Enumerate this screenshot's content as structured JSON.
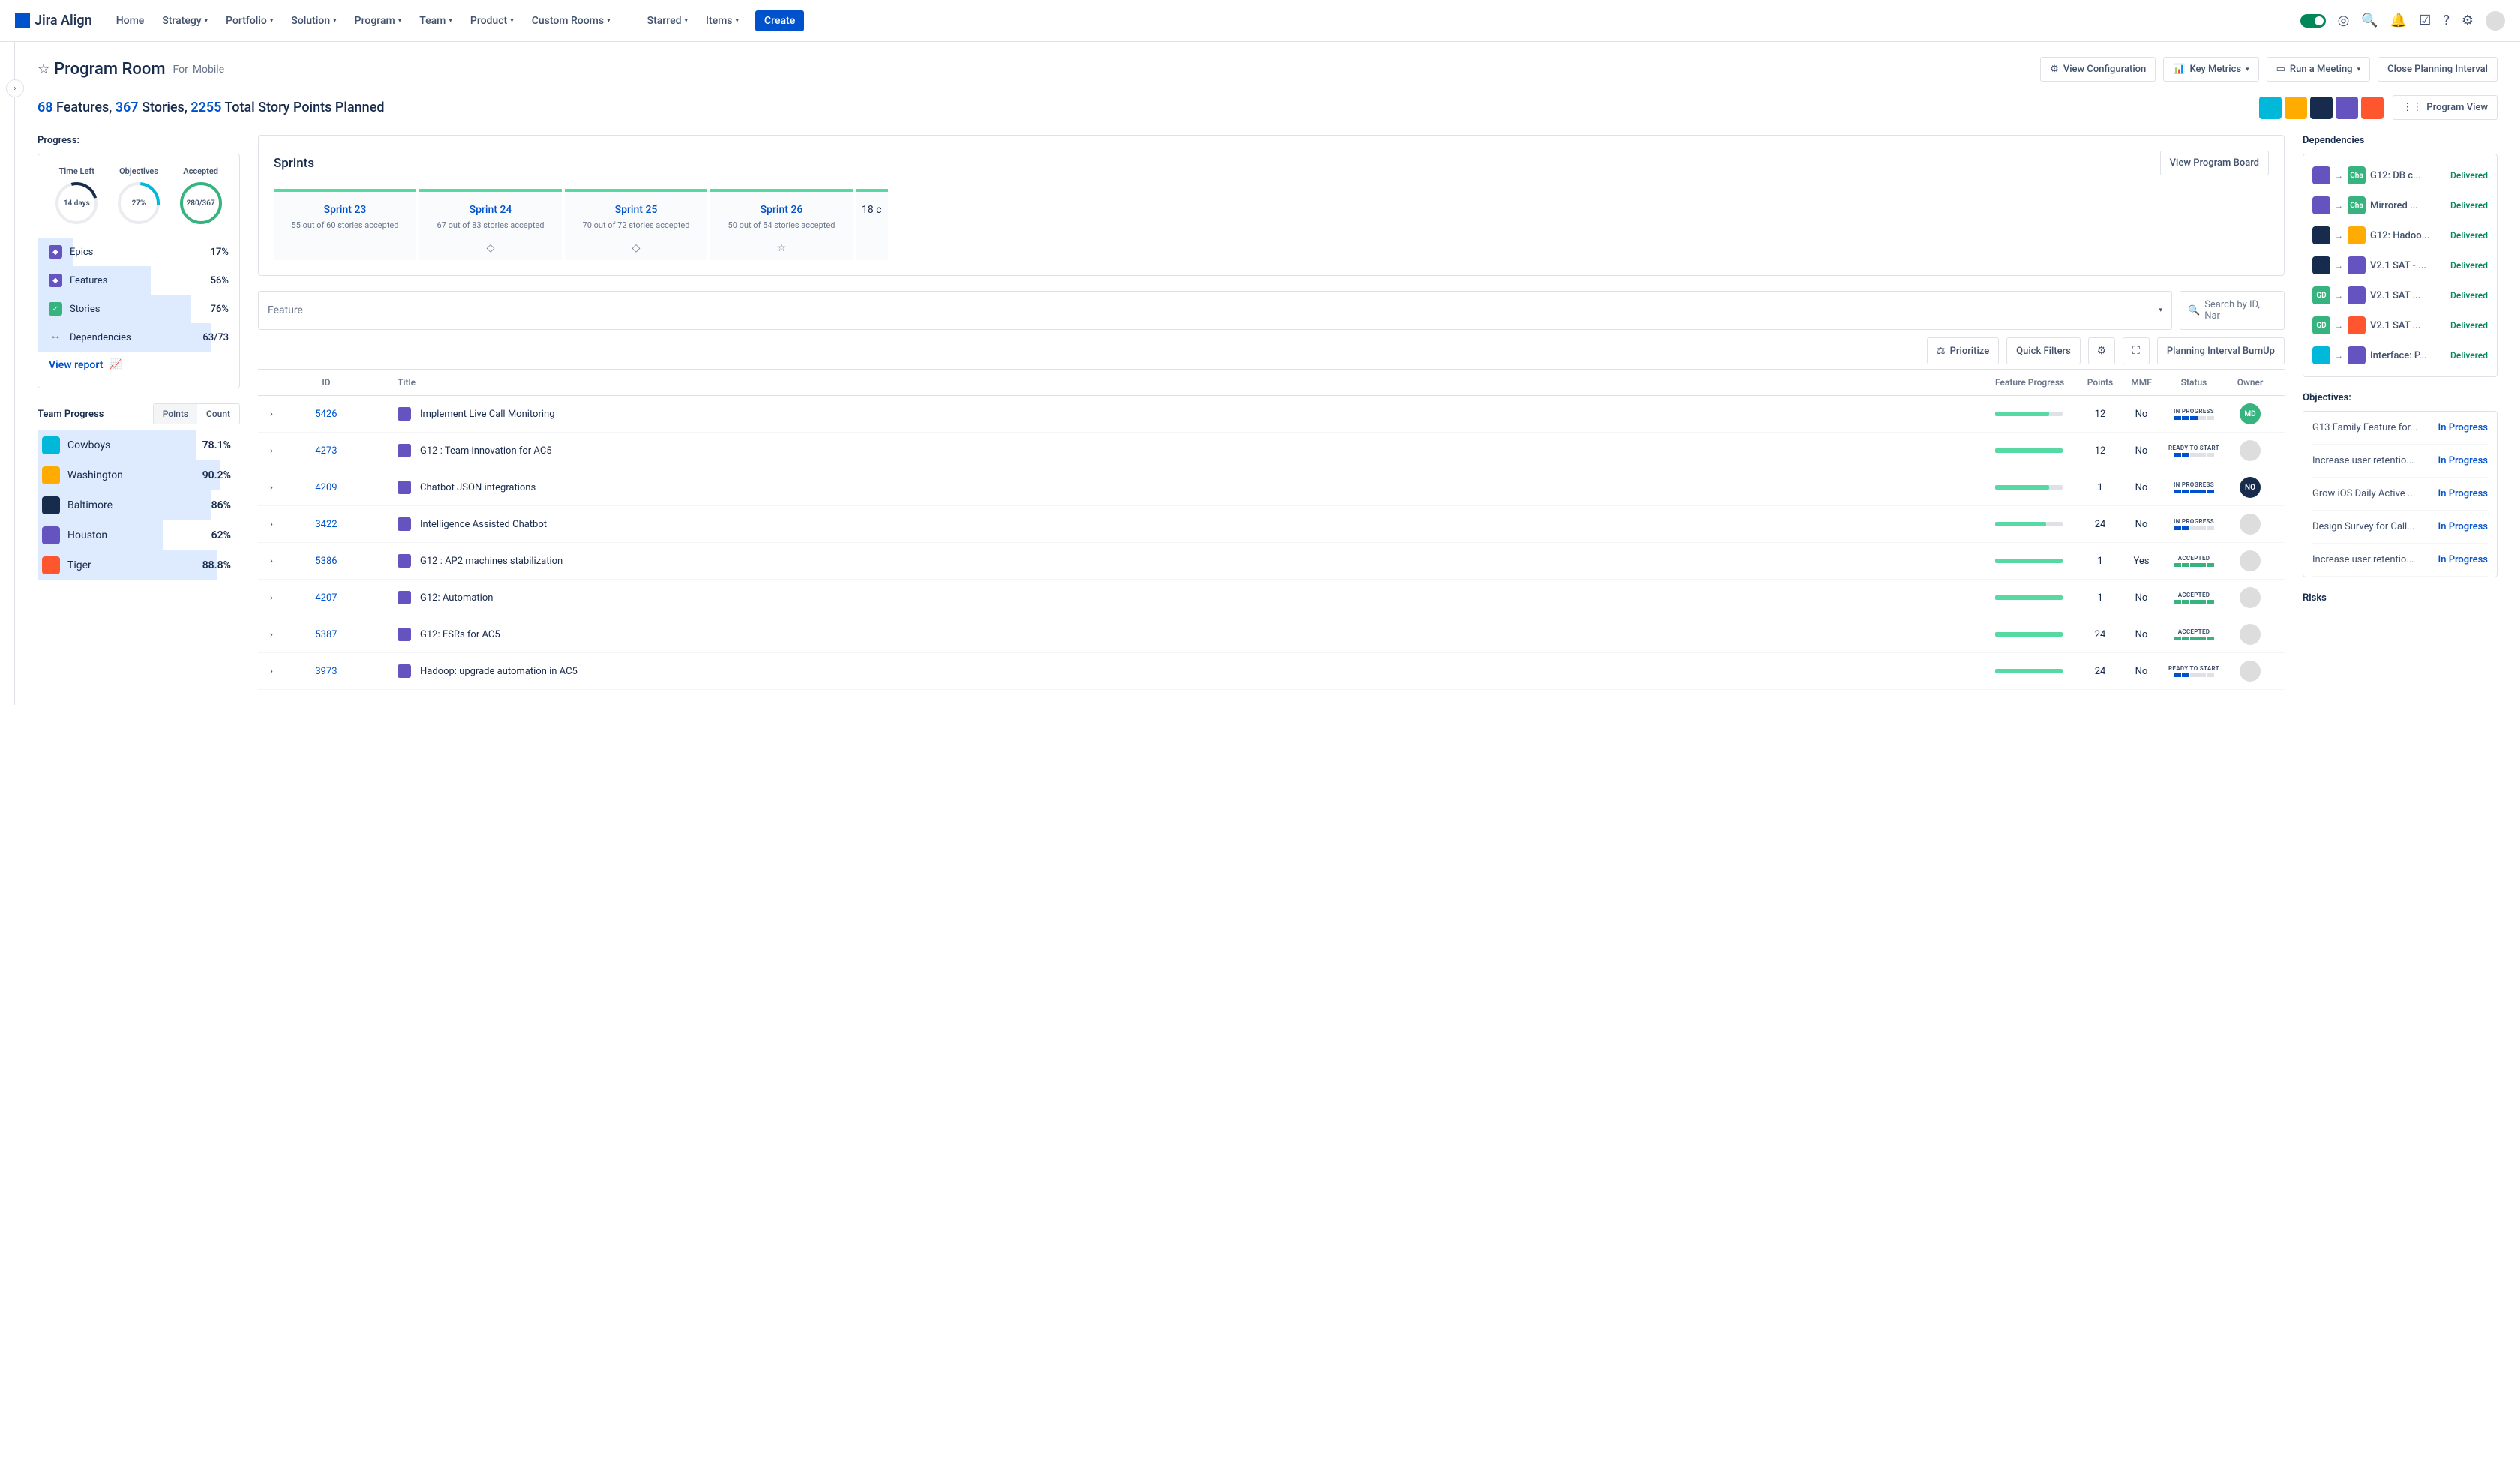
{
  "app": {
    "name": "Jira Align"
  },
  "nav": {
    "items": [
      "Home",
      "Strategy",
      "Portfolio",
      "Solution",
      "Program",
      "Team",
      "Product",
      "Custom Rooms"
    ],
    "secondary": [
      "Starred",
      "Items"
    ],
    "create": "Create"
  },
  "page": {
    "title": "Program Room",
    "for": "For",
    "context": "Mobile",
    "buttons": {
      "view_config": "View Configuration",
      "key_metrics": "Key Metrics",
      "run_meeting": "Run a Meeting",
      "close_interval": "Close Planning Interval"
    }
  },
  "stats": {
    "features": "68",
    "features_lbl": " Features, ",
    "stories": "367",
    "stories_lbl": " Stories, ",
    "points": "2255",
    "points_lbl": " Total Story Points Planned",
    "program_view": "Program View"
  },
  "progress": {
    "label": "Progress:",
    "gauges": [
      {
        "label": "Time Left",
        "value": "14 days"
      },
      {
        "label": "Objectives",
        "value": "27%"
      },
      {
        "label": "Accepted",
        "value": "280/367"
      }
    ],
    "rows": [
      {
        "icon": "epic",
        "label": "Epics",
        "value": "17%",
        "bar": 17
      },
      {
        "icon": "feat",
        "label": "Features",
        "value": "56%",
        "bar": 56
      },
      {
        "icon": "story",
        "label": "Stories",
        "value": "76%",
        "bar": 76
      },
      {
        "icon": "dep",
        "label": "Dependencies",
        "value": "63/73",
        "bar": 86
      }
    ],
    "view_report": "View report"
  },
  "team_progress": {
    "label": "Team Progress",
    "tabs": [
      "Points",
      "Count"
    ],
    "rows": [
      {
        "color": "#00B8D9",
        "name": "Cowboys",
        "value": "78.1%",
        "bar": 78
      },
      {
        "color": "#FFAB00",
        "name": "Washington",
        "value": "90.2%",
        "bar": 90
      },
      {
        "color": "#172B4D",
        "name": "Baltimore",
        "value": "86%",
        "bar": 86
      },
      {
        "color": "#6554C0",
        "name": "Houston",
        "value": "62%",
        "bar": 62
      },
      {
        "color": "#FF5630",
        "name": "Tiger",
        "value": "88.8%",
        "bar": 89
      }
    ]
  },
  "sprints": {
    "title": "Sprints",
    "view_board": "View Program Board",
    "cols": [
      {
        "name": "Sprint 23",
        "sub": "55 out of 60 stories accepted",
        "footer": ""
      },
      {
        "name": "Sprint 24",
        "sub": "67 out of 83 stories accepted",
        "footer": "◇"
      },
      {
        "name": "Sprint 25",
        "sub": "70 out of 72 stories accepted",
        "footer": "◇"
      },
      {
        "name": "Sprint 26",
        "sub": "50 out of 54 stories accepted",
        "footer": "☆"
      }
    ],
    "more": "18 c"
  },
  "filters": {
    "select": "Feature",
    "search_placeholder": "Search by ID, Nar",
    "prioritize": "Prioritize",
    "quick": "Quick Filters",
    "burnup": "Planning Interval BurnUp"
  },
  "table": {
    "headers": {
      "id": "ID",
      "title": "Title",
      "prog": "Feature Progress",
      "points": "Points",
      "mmf": "MMF",
      "status": "Status",
      "owner": "Owner"
    },
    "rows": [
      {
        "id": "5426",
        "title": "Implement Live Call Monitoring",
        "pts": "12",
        "mmf": "No",
        "status": "IN PROGRESS",
        "segs": "bbb",
        "prog": 80,
        "av": "#36B37E",
        "av_txt": "MD"
      },
      {
        "id": "4273",
        "title": "G12 : Team innovation for AC5",
        "pts": "12",
        "mmf": "No",
        "status": "READY TO START",
        "segs": "bb",
        "prog": 100,
        "av": "#ddd",
        "av_txt": ""
      },
      {
        "id": "4209",
        "title": "Chatbot JSON integrations",
        "pts": "1",
        "mmf": "No",
        "status": "IN PROGRESS",
        "segs": "bbbbb",
        "prog": 80,
        "av": "#172B4D",
        "av_txt": "NO"
      },
      {
        "id": "3422",
        "title": "Intelligence Assisted Chatbot",
        "pts": "24",
        "mmf": "No",
        "status": "IN PROGRESS",
        "segs": "bb",
        "prog": 75,
        "av": "#ddd",
        "av_txt": ""
      },
      {
        "id": "5386",
        "title": "G12 : AP2 machines stabilization",
        "pts": "1",
        "mmf": "Yes",
        "status": "ACCEPTED",
        "segs": "ggggg",
        "prog": 100,
        "av": "#ddd",
        "av_txt": ""
      },
      {
        "id": "4207",
        "title": "G12: Automation",
        "pts": "1",
        "mmf": "No",
        "status": "ACCEPTED",
        "segs": "ggggg",
        "prog": 100,
        "av": "#ddd",
        "av_txt": ""
      },
      {
        "id": "5387",
        "title": "G12: ESRs for AC5",
        "pts": "24",
        "mmf": "No",
        "status": "ACCEPTED",
        "segs": "ggggg",
        "prog": 100,
        "av": "#ddd",
        "av_txt": ""
      },
      {
        "id": "3973",
        "title": "Hadoop: upgrade automation in AC5",
        "pts": "24",
        "mmf": "No",
        "status": "READY TO START",
        "segs": "bb",
        "prog": 100,
        "av": "#ddd",
        "av_txt": ""
      }
    ]
  },
  "dependencies": {
    "label": "Dependencies",
    "rows": [
      {
        "from": "#6554C0",
        "to": "#36B37E",
        "to_txt": "Cha",
        "title": "G12: DB c...",
        "status": "Delivered"
      },
      {
        "from": "#6554C0",
        "to": "#36B37E",
        "to_txt": "Cha",
        "title": "Mirrored ...",
        "status": "Delivered"
      },
      {
        "from": "#172B4D",
        "to": "#FFAB00",
        "to_txt": "",
        "title": "G12: Hadoo...",
        "status": "Delivered"
      },
      {
        "from": "#172B4D",
        "to": "#6554C0",
        "to_txt": "",
        "title": "V2.1 SAT - ...",
        "status": "Delivered"
      },
      {
        "from": "#36B37E",
        "from_txt": "GD",
        "to": "#6554C0",
        "to_txt": "",
        "title": "V2.1 SAT ...",
        "status": "Delivered"
      },
      {
        "from": "#36B37E",
        "from_txt": "GD",
        "to": "#FF5630",
        "to_txt": "",
        "title": "V2.1 SAT ...",
        "status": "Delivered"
      },
      {
        "from": "#00B8D9",
        "to": "#6554C0",
        "to_txt": "",
        "title": "Interface: P...",
        "status": "Delivered"
      }
    ]
  },
  "objectives": {
    "label": "Objectives:",
    "rows": [
      {
        "title": "G13 Family Feature for...",
        "status": "In Progress"
      },
      {
        "title": "Increase user retentio...",
        "status": "In Progress"
      },
      {
        "title": "Grow iOS Daily Active ...",
        "status": "In Progress"
      },
      {
        "title": "Design Survey for Call...",
        "status": "In Progress"
      },
      {
        "title": "Increase user retentio...",
        "status": "In Progress"
      }
    ]
  },
  "risks_label": "Risks"
}
